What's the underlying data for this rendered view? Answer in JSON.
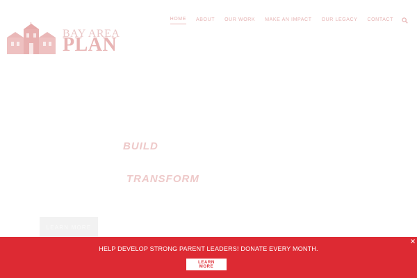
{
  "logo": {
    "line1": "BAY AREA",
    "line2": "PLAN"
  },
  "nav": {
    "items": [
      {
        "label": "HOME"
      },
      {
        "label": "ABOUT"
      },
      {
        "label": "OUR WORK"
      },
      {
        "label": "MAKE AN IMPACT"
      },
      {
        "label": "OUR LEGACY"
      },
      {
        "label": "CONTACT"
      }
    ],
    "active": "HOME"
  },
  "hero": {
    "word1": "BUILD",
    "word2": "TRANSFORM",
    "cta_label": "LEARN MORE"
  },
  "donate_bar": {
    "message": "HELP DEVELOP STRONG PARENT LEADERS! DONATE EVERY MONTH.",
    "button_label": "LEARN MORE",
    "close_symbol": "×"
  },
  "colors": {
    "accent_red": "#dd2a33",
    "faded_red": "#e8b4b4",
    "white": "#ffffff"
  },
  "icons": [
    "search-icon",
    "close-icon",
    "logo-building-icon"
  ]
}
